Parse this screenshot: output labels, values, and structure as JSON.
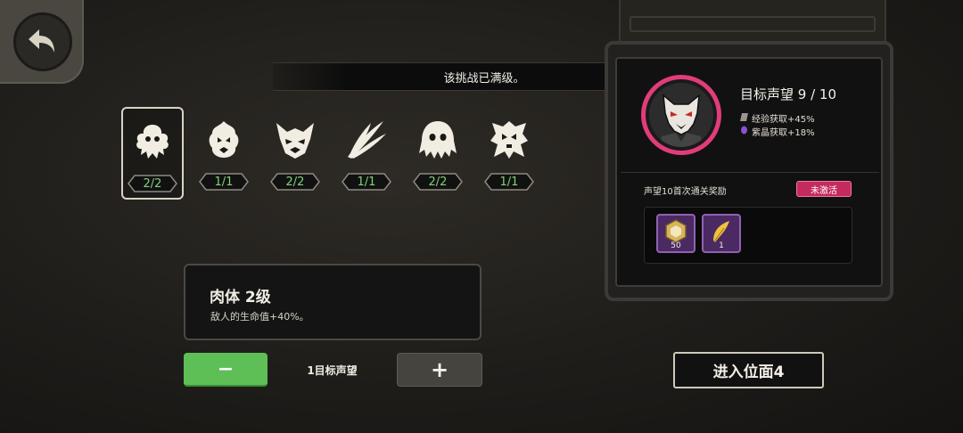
{
  "notice": "该挑战已满级。",
  "back": {
    "icon": "back-arrow-icon"
  },
  "challenges": [
    {
      "icon": "flesh-icon",
      "level": "2/2",
      "selected": true
    },
    {
      "icon": "flame-beast-icon",
      "level": "1/1",
      "selected": false
    },
    {
      "icon": "demon-mask-icon",
      "level": "2/2",
      "selected": false
    },
    {
      "icon": "claw-slash-icon",
      "level": "1/1",
      "selected": false
    },
    {
      "icon": "ghost-icon",
      "level": "2/2",
      "selected": false
    },
    {
      "icon": "skull-totem-icon",
      "level": "1/1",
      "selected": false
    }
  ],
  "detail": {
    "title": "肉体 2级",
    "text": "敌人的生命值+40%。"
  },
  "stepper": {
    "minus": "−",
    "label": "1目标声望",
    "plus": "+"
  },
  "reputation": {
    "title": "目标声望 9 / 10",
    "bonuses": [
      {
        "icon": "exp-icon",
        "text": "经验获取+45%"
      },
      {
        "icon": "crystal-icon",
        "text": "紫晶获取+18%"
      }
    ],
    "reward_title": "声望10首次通关奖励",
    "status": "未激活",
    "rewards": [
      {
        "icon": "hex-coin-icon",
        "count": "50"
      },
      {
        "icon": "feather-icon",
        "count": "1"
      }
    ]
  },
  "enter_button": "进入位面4",
  "colors": {
    "accent_pink": "#e23c7a",
    "level_green": "#7fd27a",
    "minus_green": "#5fbf57",
    "reward_purple": "#4b2a63"
  }
}
